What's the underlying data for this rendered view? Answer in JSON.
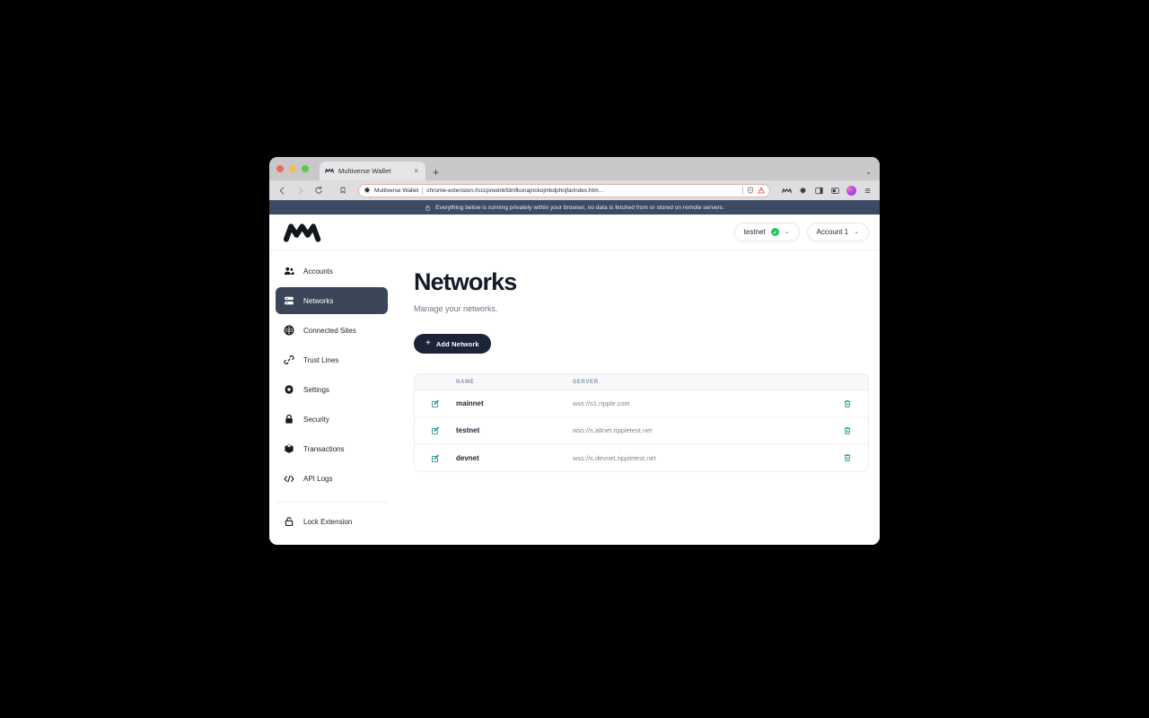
{
  "browser": {
    "traffic_lights": [
      "close",
      "minimize",
      "maximize"
    ],
    "tab": {
      "title": "Multiverse Wallet",
      "favicon": "multiverse-logo-icon",
      "close_label": "×"
    },
    "new_tab_label": "+",
    "tabstrip_chevron": "⌄",
    "nav": {
      "back": "back-icon",
      "forward": "forward-icon",
      "reload": "reload-icon",
      "bookmark": "bookmark-icon"
    },
    "omnibox": {
      "extension_name": "Multiverse Wallet",
      "url": "chrome-extension://cccpnednkfdmfkonajnckojmkdphnjfa/index.htm…",
      "shield_icon": "shield-icon",
      "warning_icon": "warning-triangle-icon"
    },
    "toolbar_icons": [
      "multiverse-extension-icon",
      "puzzle-extensions-icon",
      "side-panel-icon",
      "split-view-icon",
      "profile-avatar-icon",
      "chrome-menu-icon"
    ]
  },
  "privacy_banner": {
    "icon": "lock-icon",
    "text": "Everything below is running privately within your browser, no data is fetched from or stored on remote servers."
  },
  "header": {
    "logo": "multiverse-wallet-logo",
    "network_selector": {
      "label": "testnet",
      "status": "connected",
      "status_color": "#22c55e",
      "chevron": "⌄"
    },
    "account_selector": {
      "label": "Account 1",
      "chevron": "⌄"
    }
  },
  "sidebar": {
    "items": [
      {
        "label": "Accounts",
        "icon": "users-icon",
        "active": false
      },
      {
        "label": "Networks",
        "icon": "servers-icon",
        "active": true
      },
      {
        "label": "Connected Sites",
        "icon": "globe-icon",
        "active": false
      },
      {
        "label": "Trust Lines",
        "icon": "link-icon",
        "active": false
      },
      {
        "label": "Settings",
        "icon": "gear-icon",
        "active": false
      },
      {
        "label": "Security",
        "icon": "lock-closed-icon",
        "active": false
      },
      {
        "label": "Transactions",
        "icon": "box-icon",
        "active": false
      },
      {
        "label": "API Logs",
        "icon": "code-icon",
        "active": false
      }
    ],
    "bottom_item": {
      "label": "Lock Extension",
      "icon": "lock-open-icon"
    }
  },
  "main": {
    "title": "Networks",
    "subtitle": "Manage your networks.",
    "add_button": {
      "label": "Add Network",
      "plus": "+"
    },
    "table": {
      "columns": [
        "NAME",
        "SERVER"
      ],
      "edit_icon": "edit-pencil-icon",
      "delete_icon": "trash-icon",
      "accent_color": "#2a9d96",
      "rows": [
        {
          "name": "mainnet",
          "server": "wss://s1.ripple.com"
        },
        {
          "name": "testnet",
          "server": "wss://s.altnet.rippletest.net"
        },
        {
          "name": "devnet",
          "server": "wss://s.devnet.rippletest.net"
        }
      ]
    }
  }
}
